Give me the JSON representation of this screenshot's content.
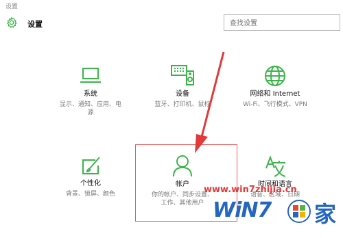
{
  "window": {
    "title": "设置"
  },
  "header": {
    "title": "设置",
    "icon": "gear-icon"
  },
  "search": {
    "placeholder": "查找设置"
  },
  "tiles": [
    {
      "label": "系统",
      "desc": "显示、通知、应用、电\n源",
      "icon": "laptop-icon"
    },
    {
      "label": "设备",
      "desc": "蓝牙、打印机、鼠标",
      "icon": "keyboard-speaker-icon"
    },
    {
      "label": "网络和 Internet",
      "desc": "Wi-Fi、飞行模式、VPN",
      "icon": "globe-icon"
    },
    {
      "label": "个性化",
      "desc": "背景、锁屏、颜色",
      "icon": "paintbrush-icon"
    },
    {
      "label": "帐户",
      "desc": "你的帐户、同步设置、\n工作、其他用户",
      "icon": "person-icon"
    },
    {
      "label": "时间和语言",
      "desc": "语音、区域、日期",
      "icon": "language-icon"
    }
  ],
  "watermark": {
    "url": "www.win7zhijia.cn",
    "logo_text": "WiN7",
    "logo_char": "家"
  },
  "colors": {
    "accent": "#3cb44a",
    "annotation": "#e23a3a",
    "watermark_blue": "#2466c0"
  }
}
